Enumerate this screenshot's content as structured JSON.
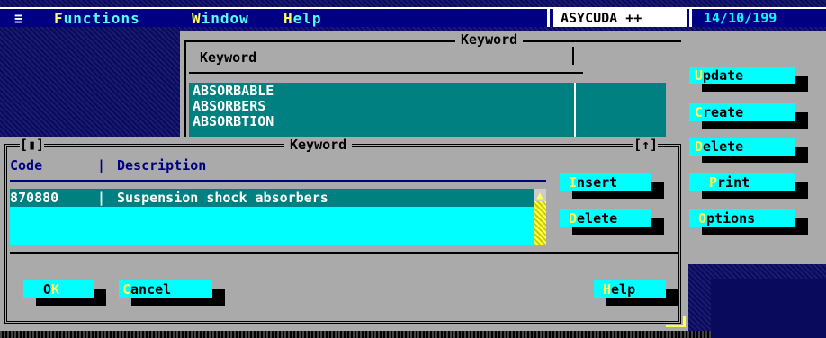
{
  "menu": {
    "system_glyph": "≡",
    "functions_hot": "F",
    "functions_rest": "unctions",
    "window_hot": "W",
    "window_rest": "indow",
    "help_hot": "H",
    "help_rest": "elp",
    "app_name": "ASYCUDA ++",
    "date": "14/10/199"
  },
  "back_window": {
    "title": "Keyword",
    "column_header": "Keyword",
    "rows": [
      "ABSORBABLE",
      "ABSORBERS",
      "ABSORBTION"
    ],
    "buttons": [
      {
        "hot": "U",
        "rest": "pdate"
      },
      {
        "hot": "C",
        "rest": "reate"
      },
      {
        "hot": "D",
        "rest": "elete"
      },
      {
        "hot": "P",
        "rest": "rint"
      },
      {
        "hot": "O",
        "rest": "ptions"
      }
    ]
  },
  "front_window": {
    "title": "Keyword",
    "left_marker": "[▮]",
    "right_marker": "[↑]",
    "col_code": "Code",
    "col_sep": "|",
    "col_desc": "Description",
    "row_code": "870880",
    "row_desc": "Suspension shock absorbers",
    "insert_hot": "I",
    "insert_rest": "nsert",
    "delete_hot": "D",
    "delete_rest": "elete",
    "ok_pre": "O",
    "ok_hot": "K",
    "cancel_hot": "C",
    "cancel_rest": "ancel",
    "help_hot": "H",
    "help_rest": "elp"
  },
  "colors": {
    "cyan": "#00ffff",
    "teal": "#008080",
    "gray": "#aaaaaa",
    "navy": "#000080",
    "yellow": "#ffff55"
  }
}
